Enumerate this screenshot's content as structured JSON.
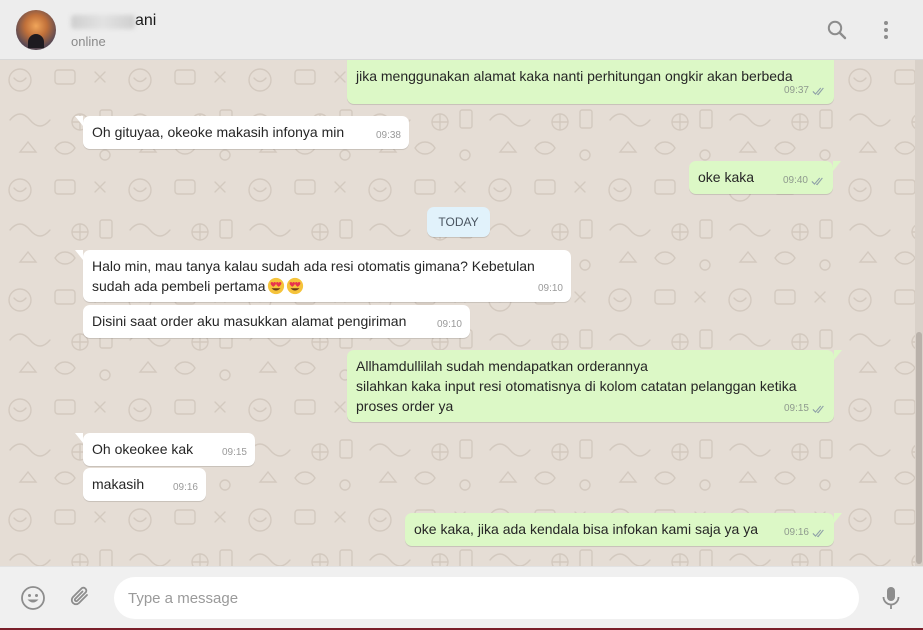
{
  "header": {
    "contact_name": "ani",
    "status": "online"
  },
  "date_separator": "TODAY",
  "messages": [
    {
      "dir": "out",
      "text": "jika menggunakan alamat kaka nanti perhitungan ongkir akan berbeda",
      "time": "09:37",
      "read": true
    },
    {
      "dir": "in",
      "text": "Oh gituyaa, okeoke makasih infonya min",
      "time": "09:38"
    },
    {
      "dir": "out",
      "text": "oke kaka",
      "time": "09:40",
      "read": true
    },
    {
      "dir": "in",
      "text": "Halo min, mau tanya kalau sudah ada resi otomatis gimana? Kebetulan\nsudah ada pembeli pertama",
      "emoji": "smiling-face-with-heart-eyes x2",
      "time": "09:10"
    },
    {
      "dir": "in",
      "text": "Disini saat order aku masukkan alamat pengiriman",
      "time": "09:10"
    },
    {
      "dir": "out",
      "text": "Allhamdullilah sudah mendapatkan orderannya\nsilahkan kaka input resi otomatisnya di kolom catatan pelanggan ketika\nproses order ya",
      "time": "09:15",
      "read": true
    },
    {
      "dir": "in",
      "text": "Oh okeokee kak",
      "time": "09:15"
    },
    {
      "dir": "in",
      "text": "makasih",
      "time": "09:16"
    },
    {
      "dir": "out",
      "text": "oke kaka, jika ada kendala bisa infokan kami saja ya ya",
      "time": "09:16",
      "read": true
    }
  ],
  "composer": {
    "placeholder": "Type a message"
  },
  "icons": [
    "search-icon",
    "menu-icon",
    "emoji-icon",
    "attach-icon",
    "mic-icon",
    "double-check-icon"
  ],
  "colors": {
    "header_bg": "#ededed",
    "chat_bg": "#e5ddd5",
    "incoming_bubble": "#ffffff",
    "outgoing_bubble": "#dcf8c6",
    "date_chip": "#e1f2fb",
    "composer_bg": "#f0f0f0"
  }
}
